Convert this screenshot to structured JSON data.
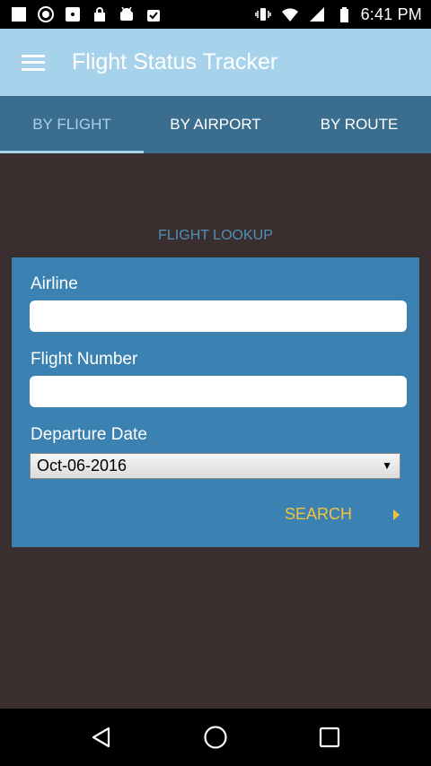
{
  "status_bar": {
    "time": "6:41 PM",
    "left_icons": [
      "square-icon",
      "record-icon",
      "dot-square-icon",
      "lock-bag-icon",
      "android-icon",
      "check-bag-icon"
    ],
    "right_icons": [
      "vibrate-icon",
      "wifi-icon",
      "signal-icon",
      "battery-icon"
    ]
  },
  "app_bar": {
    "title": "Flight Status Tracker",
    "color": "#a7d2ec"
  },
  "tabs": [
    {
      "label": "BY FLIGHT",
      "active": true
    },
    {
      "label": "BY AIRPORT",
      "active": false
    },
    {
      "label": "BY ROUTE",
      "active": false
    }
  ],
  "section": {
    "heading": "FLIGHT LOOKUP"
  },
  "form": {
    "airline": {
      "label": "Airline",
      "value": "",
      "placeholder": ""
    },
    "flight_number": {
      "label": "Flight Number",
      "value": "",
      "placeholder": ""
    },
    "departure_date": {
      "label": "Departure Date",
      "value": "Oct-06-2016"
    },
    "search_label": "SEARCH"
  },
  "nav_bar": {
    "icons": [
      "back-icon",
      "home-icon",
      "recents-icon"
    ]
  },
  "colors": {
    "background": "#3a2e2e",
    "tab_bar": "#3b6e8e",
    "card": "#3b82b3",
    "accent": "#f2c23e",
    "heading": "#4f8fb9"
  }
}
